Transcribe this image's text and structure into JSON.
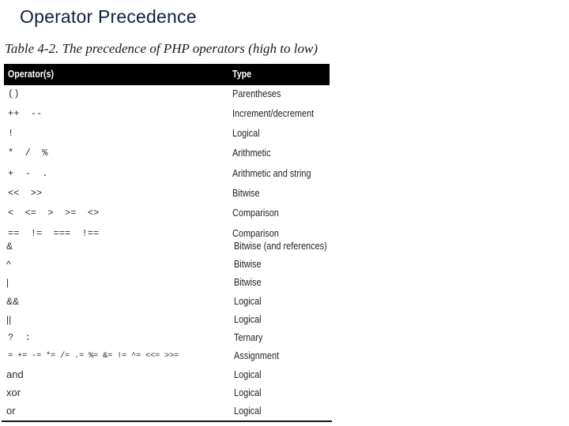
{
  "slide": {
    "title": "Operator Precedence"
  },
  "table": {
    "caption": "Table 4-2. The precedence of PHP operators (high to low)",
    "columns": {
      "operators": "Operator(s)",
      "type": "Type"
    },
    "rows": [
      {
        "operators": "()",
        "type": "Parentheses"
      },
      {
        "operators": "++  --",
        "type": "Increment/decrement"
      },
      {
        "operators": "!",
        "type": "Logical"
      },
      {
        "operators": "*  /  %",
        "type": "Arithmetic"
      },
      {
        "operators": "+  -  .",
        "type": "Arithmetic and string"
      },
      {
        "operators": "<<  >>",
        "type": "Bitwise"
      },
      {
        "operators": "<  <=  >  >=  <>",
        "type": "Comparison"
      },
      {
        "operators": "==  !=  ===  !==",
        "type": "Comparison"
      },
      {
        "operators": "&",
        "type": "Bitwise (and references)"
      },
      {
        "operators": "^",
        "type": "Bitwise"
      },
      {
        "operators": "|",
        "type": "Bitwise"
      },
      {
        "operators": "&&",
        "type": "Logical"
      },
      {
        "operators": "||",
        "type": "Logical"
      },
      {
        "operators": "?  :",
        "type": "Ternary"
      },
      {
        "operators": "= += -= *= /= .= %= &= != ^= <<= >>=",
        "type": "Assignment"
      },
      {
        "operators": "and",
        "type": "Logical"
      },
      {
        "operators": "xor",
        "type": "Logical"
      },
      {
        "operators": "or",
        "type": "Logical"
      }
    ]
  }
}
